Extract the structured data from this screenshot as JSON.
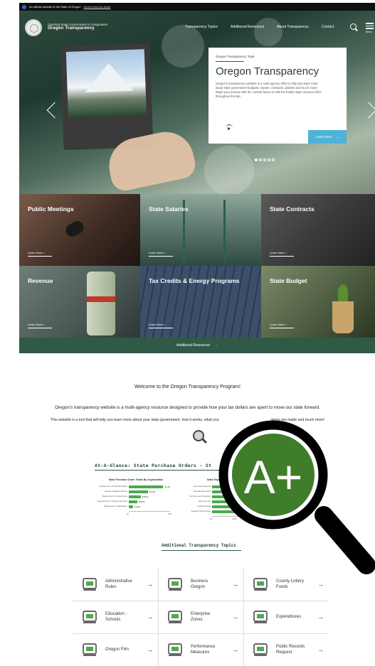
{
  "banner": {
    "text": "An official website of the State of Oregon",
    "link": "Here's how you know"
  },
  "header": {
    "tagline": "Opening State Government to Oregonians",
    "brand": "Oregon Transparency",
    "nav": [
      "Transparency Topics",
      "Additional Resources",
      "About Transparency",
      "Contact"
    ],
    "menu_label": "Menu"
  },
  "hero_card": {
    "kicker": "Oregon Transparency Topic",
    "title": "Oregon Transparency",
    "body": "Oregon's transparency website is a multi-agency effort to help you learn more about state government budgets, reports, contracts, salaries and much more! Begin your journey with the content below or with the helpful topic resource links throughout the site.",
    "button": "Learn More",
    "slides_total": 5,
    "active_slide": 1
  },
  "tiles": [
    {
      "label": "Public Meetings",
      "learn": "Learn More >"
    },
    {
      "label": "State Salaries",
      "learn": "Learn More >"
    },
    {
      "label": "State Contracts",
      "learn": "Learn More >"
    },
    {
      "label": "Revenue",
      "learn": "Learn More >"
    },
    {
      "label": "Tax Credits & Energy Programs",
      "learn": "Learn More >"
    },
    {
      "label": "State Budget",
      "learn": "Learn More >"
    }
  ],
  "additional_bar": "Additional Resources",
  "welcome": {
    "title": "Welcome to the Oregon Transparency Program!",
    "line1": "Oregon's transparency website is a multi-agency resource designed to provide how your tax dollars are spent to move our state forward.",
    "line2": "This website is a tool that will help you learn more about your state government, how it works, what you",
    "line2_end": "isions are made and much more!"
  },
  "glance_title": "At-A-Glance: State Purchase Orders - St",
  "badge": {
    "text": "A+",
    "color": "#3f7d2b"
  },
  "chart_data": [
    {
      "type": "bar",
      "title": "State Purchase Order Totals By Organization",
      "categories": [
        "Department of Transportation",
        "Oregon Health Authority",
        "Department of Corrections",
        "Department of Human Services",
        "Department of Education"
      ],
      "values": [
        1.0,
        0.55,
        0.35,
        0.25,
        0.12
      ],
      "value_labels": [
        "$1.0B",
        "$550M",
        "$350M",
        "$250M",
        "$120M"
      ],
      "ticks": [
        "$0",
        "$1B"
      ],
      "xlim": [
        0,
        1.2
      ]
    },
    {
      "type": "bar",
      "title": "State Expenditures By",
      "categories": [
        "Personal Services",
        "Special Payments",
        "Services and Supplies",
        "Debt Service",
        "Capital Outlay",
        "Capital Improvement"
      ],
      "values": [
        0.95,
        0.9,
        0.85,
        0.8,
        0.78,
        0.75
      ],
      "ticks": [
        "0M",
        "200M",
        "400M"
      ],
      "xlim": [
        0,
        1
      ]
    }
  ],
  "addl_title": "Additional Transparency Topics",
  "topics": [
    {
      "label": "Administrative Rules",
      "icon": "hands-people-icon"
    },
    {
      "label": "Business Oregon",
      "icon": "business-meeting-icon"
    },
    {
      "label": "County Lottery Funds",
      "icon": "bank-building-icon"
    },
    {
      "label": "Education - Schools",
      "icon": "graduation-books-icon"
    },
    {
      "label": "Enterprise Zones",
      "icon": "city-building-icon"
    },
    {
      "label": "Expenditures",
      "icon": "money-bills-icon"
    },
    {
      "label": "Oregon Film",
      "icon": "film-camera-icon"
    },
    {
      "label": "Performance Measures",
      "icon": "performance-chart-icon"
    },
    {
      "label": "Public Records Request",
      "icon": "records-files-icon"
    }
  ]
}
